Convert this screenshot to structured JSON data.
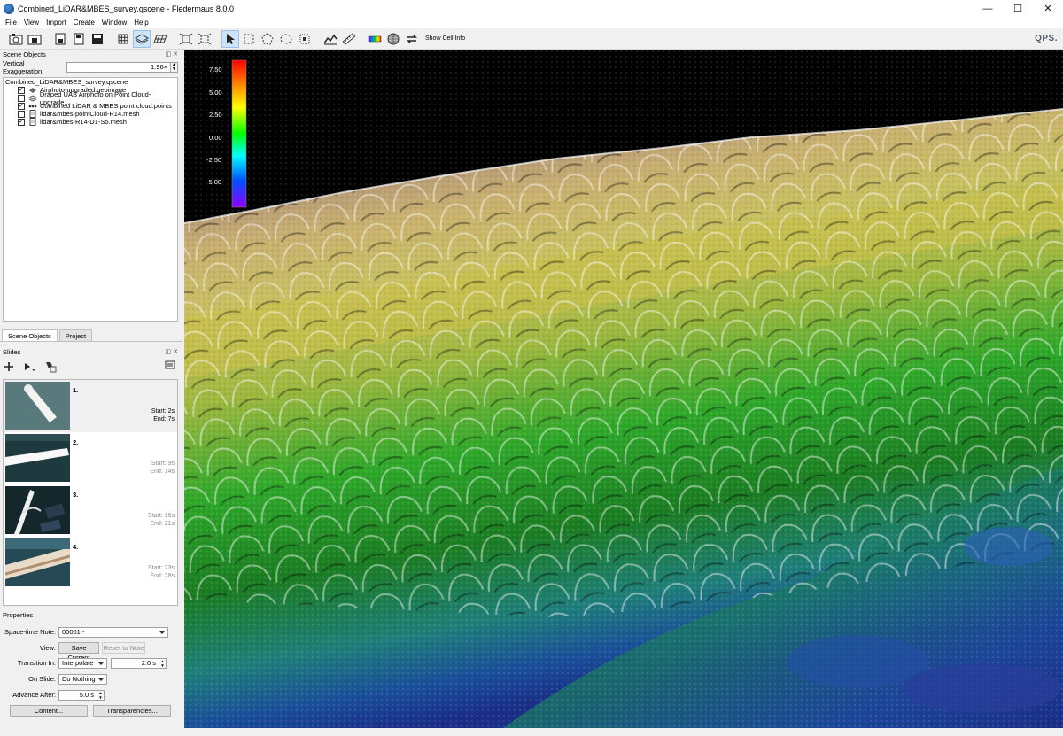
{
  "window": {
    "title": "Combined_LiDAR&MBES_survey.qscene - Fledermaus 8.0.0",
    "controls": [
      "—",
      "☐",
      "✕"
    ]
  },
  "menu": [
    "File",
    "View",
    "Import",
    "Create",
    "Window",
    "Help"
  ],
  "toolbar": {
    "show_cell_info_label": "Show Cell Info",
    "logo_text": "QPS."
  },
  "scene_objects": {
    "header": "Scene Objects",
    "vertical_exaggeration_label": "Vertical Exaggeration:",
    "vertical_exaggeration_value": "1.96×",
    "root": "Combined_LiDAR&MBES_survey.qscene",
    "items": [
      {
        "label": "Airphoto-upgraded.geoimage",
        "checked": true,
        "icon": "image-layer-icon"
      },
      {
        "label": "Draped UAS Airphoto on Point Cloud-upgrade...",
        "checked": false,
        "icon": "drape-layer-icon"
      },
      {
        "label": "Combined LiDAR & MBES point cloud.points",
        "checked": true,
        "icon": "points-layer-icon"
      },
      {
        "label": "lidar&mbes-pointCloud-R14.mesh",
        "checked": false,
        "icon": "mesh-file-icon"
      },
      {
        "label": "lidar&mbes-R14-D1-S5.mesh",
        "checked": true,
        "icon": "mesh-file-icon"
      }
    ]
  },
  "left_tabs": [
    {
      "label": "Scene Objects",
      "active": true
    },
    {
      "label": "Project",
      "active": false
    }
  ],
  "slides": {
    "header": "Slides",
    "items": [
      {
        "number": "1.",
        "start": "Start: 2s",
        "end": "End: 7s",
        "selected": true
      },
      {
        "number": "2.",
        "start": "Start: 9s",
        "end": "End: 14s",
        "selected": false
      },
      {
        "number": "3.",
        "start": "Start: 16s",
        "end": "End: 21s",
        "selected": false
      },
      {
        "number": "4.",
        "start": "Start: 23s",
        "end": "End: 28s",
        "selected": false
      }
    ]
  },
  "properties": {
    "header": "Properties",
    "space_time_note_label": "Space-time Note:",
    "space_time_note_value": "00001 -",
    "view_label": "View:",
    "save_current": "Save Current",
    "reset_to_note": "Reset to Note",
    "transition_in_label": "Transition In:",
    "transition_in_value": "Interpolate",
    "transition_duration": "2.0 s",
    "on_slide_label": "On Slide:",
    "on_slide_value": "Do Nothing",
    "advance_after_label": "Advance After:",
    "advance_after_value": "5.0 s",
    "content_button": "Content...",
    "transparencies_button": "Transparencies..."
  },
  "colorbar": {
    "ticks": [
      "7.50",
      "5.00",
      "2.50",
      "0.00",
      "-2.50",
      "-5.00"
    ],
    "colors": [
      "#ff0000",
      "#ffff00",
      "#00ff00",
      "#00ffff",
      "#0000ff",
      "#8000ff"
    ]
  }
}
